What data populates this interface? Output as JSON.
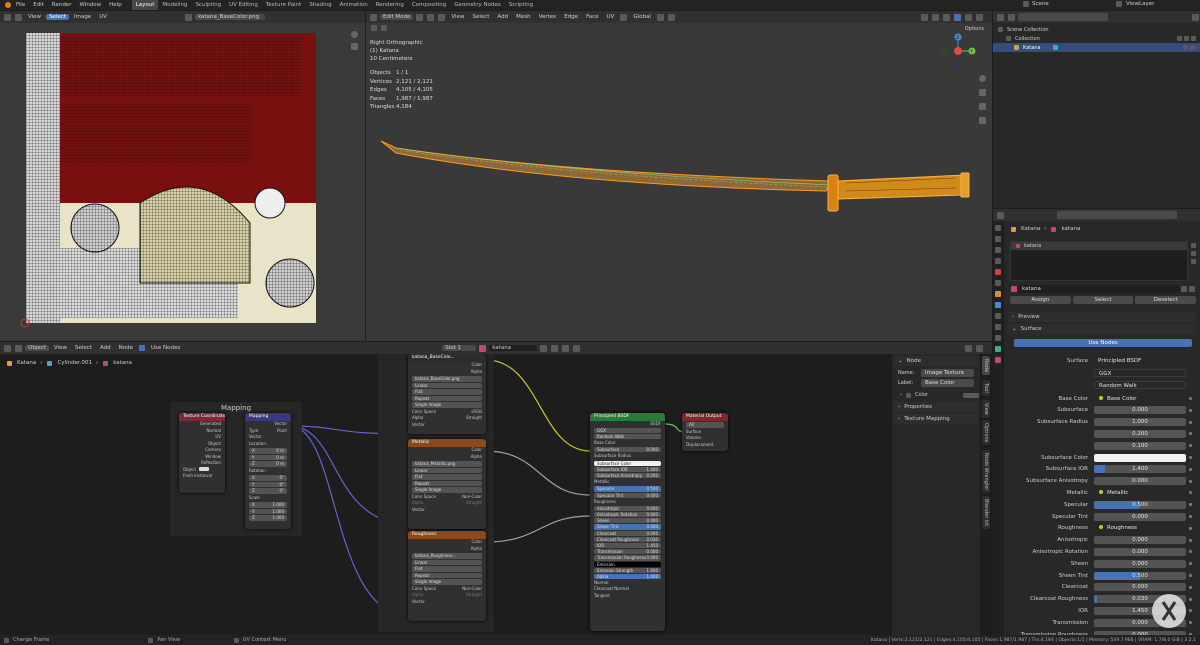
{
  "menu": [
    "File",
    "Edit",
    "Render",
    "Window",
    "Help"
  ],
  "workspaces": [
    "Layout",
    "Modeling",
    "Sculpting",
    "UV Editing",
    "Texture Paint",
    "Shading",
    "Animation",
    "Rendering",
    "Compositing",
    "Geometry Nodes",
    "Scripting"
  ],
  "active_workspace_index": 0,
  "scene": "Scene",
  "view_layer": "ViewLayer",
  "uv_editor": {
    "header": [
      "View",
      "Select",
      "Image",
      "UV"
    ],
    "select_active": "Select",
    "image_name": "katana_BaseColor.png"
  },
  "viewport": {
    "mode": "Edit Mode",
    "menus": [
      "View",
      "Select",
      "Add",
      "Mesh",
      "Vertex",
      "Edge",
      "Face",
      "UV"
    ],
    "orientation": "Global",
    "options": "Options",
    "overlay_lines": [
      "Right Orthographic",
      "(1) Katana",
      "10 Centimeters"
    ],
    "stats": [
      {
        "k": "Objects",
        "v": "1 / 1"
      },
      {
        "k": "Vertices",
        "v": "2,121 / 2,121"
      },
      {
        "k": "Edges",
        "v": "4,105 / 4,105"
      },
      {
        "k": "Faces",
        "v": "1,987 / 1,987"
      },
      {
        "k": "Triangles",
        "v": "4,184"
      }
    ],
    "gizmo": {
      "y": "Y",
      "z": "Z"
    }
  },
  "outliner": {
    "items": [
      {
        "label": "Scene Collection",
        "indent": 0,
        "selected": false
      },
      {
        "label": "Collection",
        "indent": 1,
        "selected": false
      },
      {
        "label": "Katana",
        "indent": 2,
        "selected": true
      }
    ]
  },
  "node_editor": {
    "header": {
      "object_mode": "Object",
      "menus": [
        "View",
        "Select",
        "Add",
        "Node"
      ],
      "use_nodes": "Use Nodes",
      "slot": "Slot 1",
      "material": "katana"
    },
    "breadcrumb": [
      "Katana",
      "Cylinder.001",
      "katana"
    ],
    "frame_label": "Mapping",
    "texcoord": {
      "title": "Texture Coordinate",
      "outputs": [
        "Generated",
        "Normal",
        "UV",
        "Object",
        "Camera",
        "Window",
        "Reflection"
      ],
      "object_label": "Object",
      "from_instancer": "From Instancer"
    },
    "mapping": {
      "title": "Mapping",
      "output": "Vector",
      "type_label": "Type",
      "type_value": "Point",
      "vector": "Vector",
      "location": "Location",
      "rotation": "Rotation",
      "scale": "Scale",
      "loc": [
        "0 m",
        "0 m",
        "0 m"
      ],
      "rot": [
        "0°",
        "0°",
        "0°"
      ],
      "scl": [
        "1.000",
        "1.000",
        "1.000"
      ],
      "axes": [
        "X",
        "Y",
        "Z"
      ]
    },
    "tex1": {
      "title": "katana_BaseColo...",
      "image": "katana_BaseColor.png",
      "outputs": [
        "Color",
        "Alpha"
      ],
      "interp": "Linear",
      "proj": "Flat",
      "ext": "Repeat",
      "source": "Single Image",
      "cs_label": "Color Space",
      "cs_value": "sRGB",
      "alpha_label": "Alpha",
      "alpha_value": "Straight",
      "vector": "Vector"
    },
    "tex2": {
      "title": "Metallic",
      "image": "katana_Metallic.png",
      "outputs": [
        "Color",
        "Alpha"
      ],
      "interp": "Linear",
      "proj": "Flat",
      "ext": "Repeat",
      "source": "Single Image",
      "cs_label": "Color Space",
      "cs_value": "Non-Color",
      "alpha_label": "Alpha",
      "alpha_value": "Straight",
      "vector": "Vector"
    },
    "tex3": {
      "title": "Roughness",
      "image": "katana_Roughness...",
      "outputs": [
        "Color",
        "Alpha"
      ],
      "interp": "Linear",
      "proj": "Flat",
      "ext": "Repeat",
      "source": "Single Image",
      "cs_label": "Color Space",
      "cs_value": "Non-Color",
      "alpha_label": "Alpha",
      "alpha_value": "Straight",
      "vector": "Vector"
    },
    "bsdf": {
      "title": "Principled BSDF",
      "output": "BSDF",
      "dist": "GGX",
      "sss": "Random Walk",
      "rows": [
        {
          "l": "Base Color",
          "v": "",
          "t": "socket"
        },
        {
          "l": "Subsurface",
          "v": "0.000",
          "t": "field"
        },
        {
          "l": "Subsurface Radius",
          "v": "",
          "t": "dd"
        },
        {
          "l": "Subsurface Color",
          "v": "",
          "t": "white"
        },
        {
          "l": "Subsurface IOR",
          "v": "1.400",
          "t": "field"
        },
        {
          "l": "Subsurface Anisotropy",
          "v": "0.000",
          "t": "field"
        },
        {
          "l": "Metallic",
          "v": "",
          "t": "socket"
        },
        {
          "l": "Specular",
          "v": "0.500",
          "t": "blue"
        },
        {
          "l": "Specular Tint",
          "v": "0.000",
          "t": "field"
        },
        {
          "l": "Roughness",
          "v": "",
          "t": "socket"
        },
        {
          "l": "Anisotropic",
          "v": "0.000",
          "t": "field"
        },
        {
          "l": "Anisotropic Rotation",
          "v": "0.000",
          "t": "field"
        },
        {
          "l": "Sheen",
          "v": "0.000",
          "t": "field"
        },
        {
          "l": "Sheen Tint",
          "v": "0.500",
          "t": "blue"
        },
        {
          "l": "Clearcoat",
          "v": "0.000",
          "t": "field"
        },
        {
          "l": "Clearcoat Roughness",
          "v": "0.030",
          "t": "field"
        },
        {
          "l": "IOR",
          "v": "1.450",
          "t": "field"
        },
        {
          "l": "Transmission",
          "v": "0.000",
          "t": "field"
        },
        {
          "l": "Transmission Roughness",
          "v": "0.000",
          "t": "field"
        },
        {
          "l": "Emission",
          "v": "",
          "t": "black"
        },
        {
          "l": "Emission Strength",
          "v": "1.000",
          "t": "field"
        },
        {
          "l": "Alpha",
          "v": "1.000",
          "t": "blue"
        },
        {
          "l": "Normal",
          "v": "",
          "t": "socket"
        },
        {
          "l": "Clearcoat Normal",
          "v": "",
          "t": "socket"
        },
        {
          "l": "Tangent",
          "v": "",
          "t": "socket"
        }
      ]
    },
    "output_node": {
      "title": "Material Output",
      "target": "All",
      "inputs": [
        "Surface",
        "Volume",
        "Displacement"
      ]
    },
    "sidebar": {
      "section": "Node",
      "name_label": "Name:",
      "name_value": "Image Texture",
      "label_label": "Label:",
      "label_value": "Base Color",
      "color_label": "Color",
      "properties": "Properties",
      "texture_mapping": "Texture Mapping"
    },
    "vtabs": [
      "Node",
      "Tool",
      "View",
      "Options",
      "Node Wrangler",
      "Blender kit"
    ]
  },
  "properties": {
    "breadcrumb": [
      "Katana",
      "katana"
    ],
    "slot_name": "katana",
    "material_name": "katana",
    "assign": "Assign",
    "select": "Select",
    "deselect": "Deselect",
    "preview": "Preview",
    "surface_section": "Surface",
    "use_nodes": "Use Nodes",
    "surface_label": "Surface",
    "surface_value": "Principled BSDF",
    "distribution": "GGX",
    "subsurface_method": "Random Walk",
    "rows": [
      {
        "l": "Base Color",
        "v": "Base Color",
        "t": "link"
      },
      {
        "l": "Subsurface",
        "v": "0.000",
        "t": "num",
        "f": 0
      },
      {
        "l": "Subsurface Radius",
        "v": "1.000",
        "t": "num",
        "f": 0
      },
      {
        "l": "",
        "v": "0.200",
        "t": "num",
        "f": 0
      },
      {
        "l": "",
        "v": "0.100",
        "t": "num",
        "f": 0
      },
      {
        "l": "Subsurface Color",
        "v": "",
        "t": "white",
        "f": 0
      },
      {
        "l": "Subsurface IOR",
        "v": "1.400",
        "t": "num",
        "f": 0.12
      },
      {
        "l": "Subsurface Anisotropy",
        "v": "0.000",
        "t": "num",
        "f": 0
      },
      {
        "l": "Metallic",
        "v": "Metallic",
        "t": "link"
      },
      {
        "l": "Specular",
        "v": "0.500",
        "t": "num",
        "f": 0.5
      },
      {
        "l": "Specular Tint",
        "v": "0.000",
        "t": "num",
        "f": 0
      },
      {
        "l": "Roughness",
        "v": "Roughness",
        "t": "link"
      },
      {
        "l": "Anisotropic",
        "v": "0.000",
        "t": "num",
        "f": 0
      },
      {
        "l": "Anisotropic Rotation",
        "v": "0.000",
        "t": "num",
        "f": 0
      },
      {
        "l": "Sheen",
        "v": "0.000",
        "t": "num",
        "f": 0
      },
      {
        "l": "Sheen Tint",
        "v": "0.500",
        "t": "num",
        "f": 0.5
      },
      {
        "l": "Clearcoat",
        "v": "0.000",
        "t": "num",
        "f": 0
      },
      {
        "l": "Clearcoat Roughness",
        "v": "0.030",
        "t": "num",
        "f": 0.03
      },
      {
        "l": "IOR",
        "v": "1.450",
        "t": "num",
        "f": 0
      },
      {
        "l": "Transmission",
        "v": "0.000",
        "t": "num",
        "f": 0
      },
      {
        "l": "Transmission Roughness",
        "v": "0.000",
        "t": "num",
        "f": 0
      }
    ]
  },
  "statusbar": {
    "left": [
      "Change Frame",
      "Pan View",
      "UV Context Menu"
    ],
    "right": "Katana | Verts:2,121/2,121 | Edges:4,105/4,105 | Faces:1,987/1,987 | Tris:4,184 | Objects:1/1 | Memory: 549.7 MiB | VRAM: 1.7/8.0 GiB | 3.2.1"
  },
  "colors": {
    "accent": "#4772b3",
    "texnode": "#8a4a1a",
    "bsdf": "#2a7a3a",
    "output": "#7a2a2a",
    "coord": "#7a2a3a",
    "mapping": "#3a3a7a"
  }
}
